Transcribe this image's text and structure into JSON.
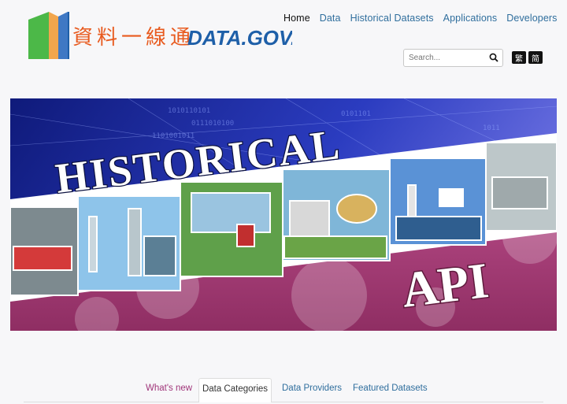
{
  "logo": {
    "chinese": "資料一線通",
    "english": "DATA.GOV.HK"
  },
  "nav": {
    "items": [
      {
        "label": "Home",
        "active": true
      },
      {
        "label": "Data"
      },
      {
        "label": "Historical Datasets"
      },
      {
        "label": "Applications"
      },
      {
        "label": "Developers"
      }
    ]
  },
  "search": {
    "placeholder": "Search...",
    "icon": "search-icon"
  },
  "language": {
    "traditional": "繁",
    "simplified": "简"
  },
  "banner": {
    "title": "HISTORICAL",
    "subtitle": "API"
  },
  "tabs": {
    "whats_new": "What's new",
    "data_categories": "Data Categories",
    "data_providers": "Data Providers",
    "featured_datasets": "Featured Datasets"
  },
  "colors": {
    "nav_link": "#2f6e9d",
    "logo_orange": "#e85a1e",
    "logo_blue": "#1e5fa8",
    "logo_green": "#4cb848",
    "banner_magenta": "#a63c75",
    "banner_blue": "#2b3cc0",
    "whats_new": "#a0357a"
  }
}
